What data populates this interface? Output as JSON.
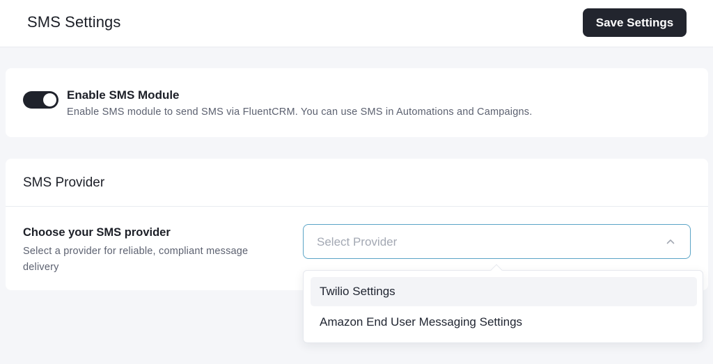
{
  "header": {
    "title": "SMS Settings",
    "save_label": "Save Settings"
  },
  "sms_module": {
    "enabled": true,
    "title": "Enable SMS Module",
    "description": "Enable SMS module to send SMS via FluentCRM. You can use SMS in Automations and Campaigns."
  },
  "provider": {
    "heading": "SMS Provider",
    "label": "Choose your SMS provider",
    "description": "Select a provider for reliable, compliant message delivery",
    "placeholder": "Select Provider",
    "options": [
      {
        "label": "Twilio Settings",
        "hovered": true
      },
      {
        "label": "Amazon End User Messaging Settings",
        "hovered": false
      }
    ]
  },
  "colors": {
    "primary_dark": "#22252e",
    "focus_border": "#5aa4c6",
    "background": "#f5f6f9"
  }
}
